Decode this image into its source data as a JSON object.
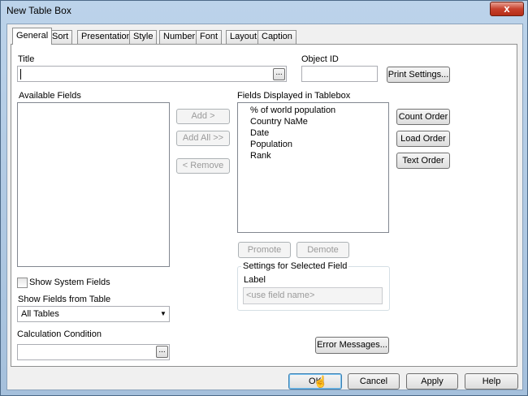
{
  "window": {
    "title": "New Table Box",
    "close_glyph": "x"
  },
  "tabs": [
    {
      "label": "General"
    },
    {
      "label": "Sort"
    },
    {
      "label": "Presentation"
    },
    {
      "label": "Style"
    },
    {
      "label": "Number"
    },
    {
      "label": "Font"
    },
    {
      "label": "Layout"
    },
    {
      "label": "Caption"
    }
  ],
  "general": {
    "title_label": "Title",
    "title_value": "",
    "ellipsis": "...",
    "object_id_label": "Object ID",
    "object_id_value": "",
    "print_settings": "Print Settings...",
    "available_fields_label": "Available Fields",
    "fields_displayed_label": "Fields Displayed in Tablebox",
    "fields_displayed": [
      "% of world population",
      "Country NaMe",
      "Date",
      "Population",
      "Rank"
    ],
    "add": "Add >",
    "add_all": "Add All >>",
    "remove": "< Remove",
    "count_order": "Count Order",
    "load_order": "Load Order",
    "text_order": "Text Order",
    "promote": "Promote",
    "demote": "Demote",
    "settings_group": "Settings for Selected Field",
    "settings_label": "Label",
    "settings_label_placeholder": "<use field name>",
    "show_system_fields": "Show System Fields",
    "show_fields_from_table": "Show Fields from Table",
    "table_selected": "All Tables",
    "calculation_condition": "Calculation Condition",
    "error_messages": "Error Messages..."
  },
  "footer": {
    "ok": "OK",
    "cancel": "Cancel",
    "apply": "Apply",
    "help": "Help"
  }
}
